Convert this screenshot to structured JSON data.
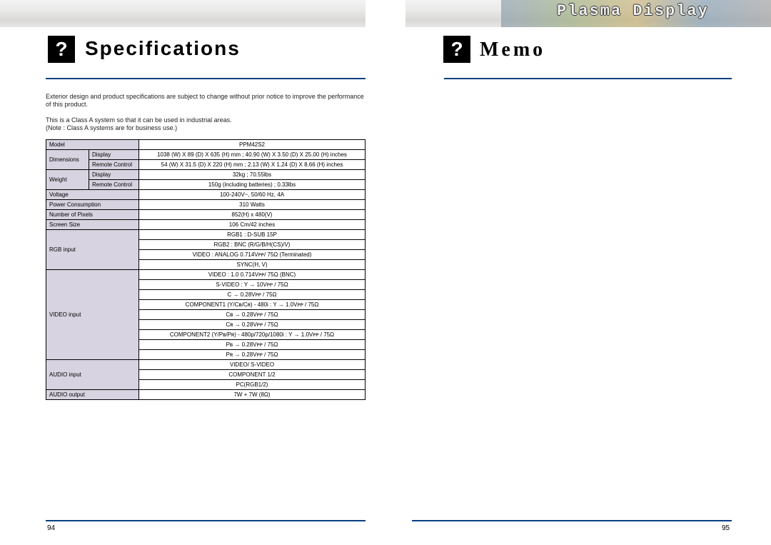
{
  "brand": "Plasma Display",
  "titles": {
    "spec": "Specifications",
    "memo": "Memo"
  },
  "notes": {
    "n1": "Exterior design and product specifications are subject to change without prior notice to improve the performance of this product.",
    "n2a": "This is a Class A system so that it can be used in industrial areas.",
    "n2b": "(Note : Class A systems are for business use.)"
  },
  "labels": {
    "model": "Model",
    "dimensions": "Dimensions",
    "display": "Display",
    "remote": "Remote Control",
    "weight": "Weight",
    "voltage": "Voltage",
    "power": "Power Consumption",
    "pixels": "Number of Pixels",
    "screen": "Screen Size",
    "rgb": "RGB input",
    "video": "VIDEO input",
    "audioIn": "AUDIO input",
    "audioOut": "AUDIO output"
  },
  "values": {
    "model": "PPM42S2",
    "dimDisplay": "1038 (W) X 89 (D) X 635 (H) mm ; 40.90 (W) X 3.50 (D) X 25.00 (H) inches",
    "dimRemote": "54 (W) X 31.5 (D) X 220 (H) mm ; 2.13 (W) X 1.24 (D) X 8.66 (H) inches",
    "wDisplay": "32kg ; 70.55lbs",
    "wRemote": "150g (including batteries) ; 0.33lbs",
    "voltage": "100-240V~, 50/60 Hz, 4A",
    "power": "310 Watts",
    "pixels": "852(H) x 480(V)",
    "screen": "106 Cm/42 inches",
    "rgb1": "RGB1 : D-SUB 15P",
    "rgb2": "RGB2 : BNC (R/G/B/H(CS)/V)",
    "rgb3": "VIDEO : ANALOG 0.714Vᴘᴘ/ 75Ω (Terminated)",
    "rgb4": "SYNC(H, V)",
    "vid1": "VIDEO : 1.0 0.714Vᴘᴘ/ 75Ω (BNC)",
    "vid2": "S-VIDEO : Y → 10Vᴘᴘ / 75Ω",
    "vid3": "C → 0.28Vᴘᴘ / 75Ω",
    "vid4": "COMPONENT1 (Y/Cʙ/Cʀ) - 480i    : Y → 1.0Vᴘᴘ / 75Ω",
    "vid5": "Cʙ → 0.28Vᴘᴘ / 75Ω",
    "vid6": "Cʀ → 0.28Vᴘᴘ / 75Ω",
    "vid7": "COMPONENT2 (Y/Pʙ/Pʀ) - 480p/720p/1080i : Y → 1.0Vᴘᴘ / 75Ω",
    "vid8": "Pʙ → 0.28Vᴘᴘ / 75Ω",
    "vid9": "Pʀ → 0.28Vᴘᴘ / 75Ω",
    "aIn1": "VIDEO/ S-VIDEO",
    "aIn2": "COMPONENT 1/2",
    "aIn3": "PC(RGB1/2)",
    "aOut": "7W + 7W (8Ω)"
  },
  "pages": {
    "left": "94",
    "right": "95"
  }
}
